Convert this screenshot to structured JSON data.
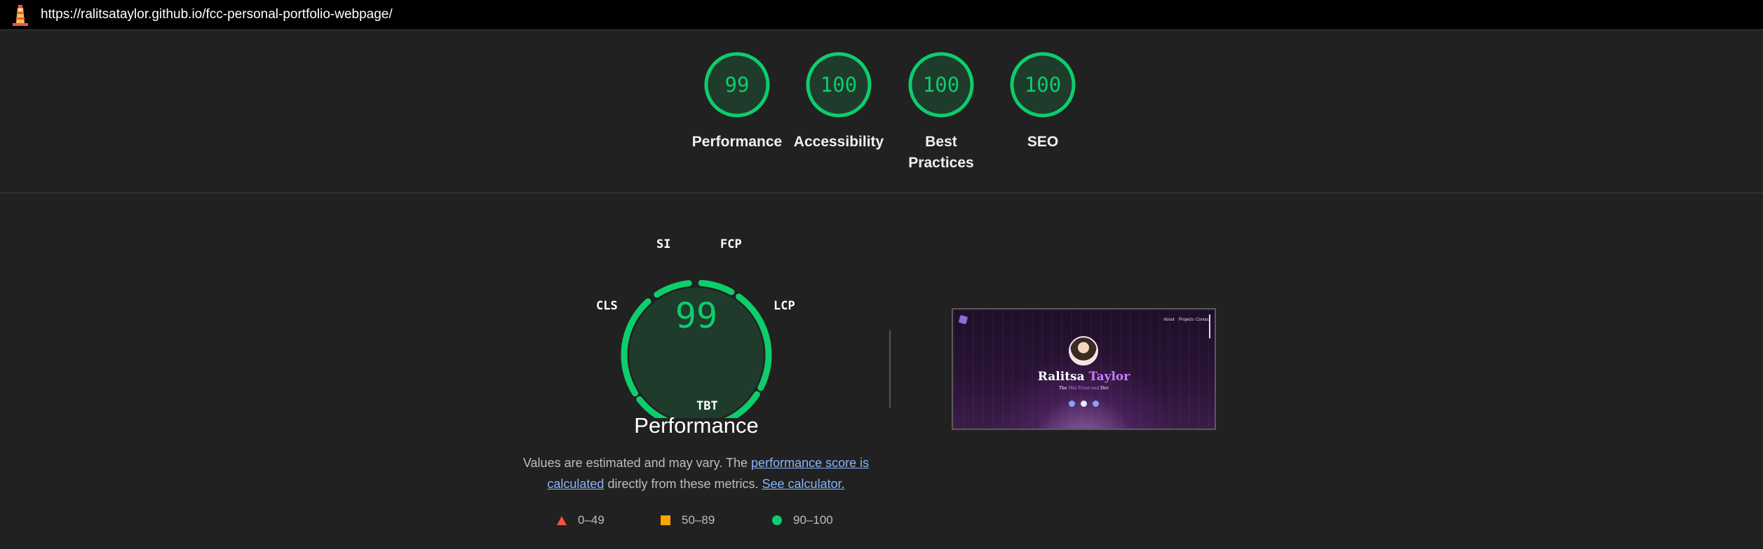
{
  "topbar": {
    "url": "https://ralitsataylor.github.io/fcc-personal-portfolio-webpage/"
  },
  "categories": [
    {
      "score": "99",
      "label_line1": "Performance",
      "label_line2": ""
    },
    {
      "score": "100",
      "label_line1": "Accessibility",
      "label_line2": ""
    },
    {
      "score": "100",
      "label_line1": "Best",
      "label_line2": "Practices"
    },
    {
      "score": "100",
      "label_line1": "SEO",
      "label_line2": ""
    }
  ],
  "performance": {
    "score": "99",
    "title": "Performance",
    "metrics": {
      "si": "SI",
      "fcp": "FCP",
      "lcp": "LCP",
      "tbt": "TBT",
      "cls": "CLS"
    },
    "desc_before": "Values are estimated and may vary. The ",
    "desc_link1": "performance score is calculated",
    "desc_middle": " directly from these metrics. ",
    "desc_link2": "See calculator."
  },
  "legend": {
    "fail": "0–49",
    "average": "50–89",
    "pass": "90–100"
  },
  "thumbnail": {
    "nav_about": "About",
    "nav_projects": "Projects",
    "nav_contact": "Contact",
    "name_first": "Ralitsa",
    "name_last": "Taylor",
    "tag_before": "The",
    "tag_accent": "Mid Front-end",
    "tag_after": "Dev"
  },
  "colors": {
    "pass": "#0cce6b",
    "average": "#ffa400",
    "fail": "#ff4e42",
    "background": "#212121",
    "topbar": "#000000"
  },
  "icons": {
    "lighthouse": "lighthouse-icon",
    "fail": "red-triangle-icon",
    "average": "orange-square-icon",
    "pass": "green-circle-icon"
  }
}
